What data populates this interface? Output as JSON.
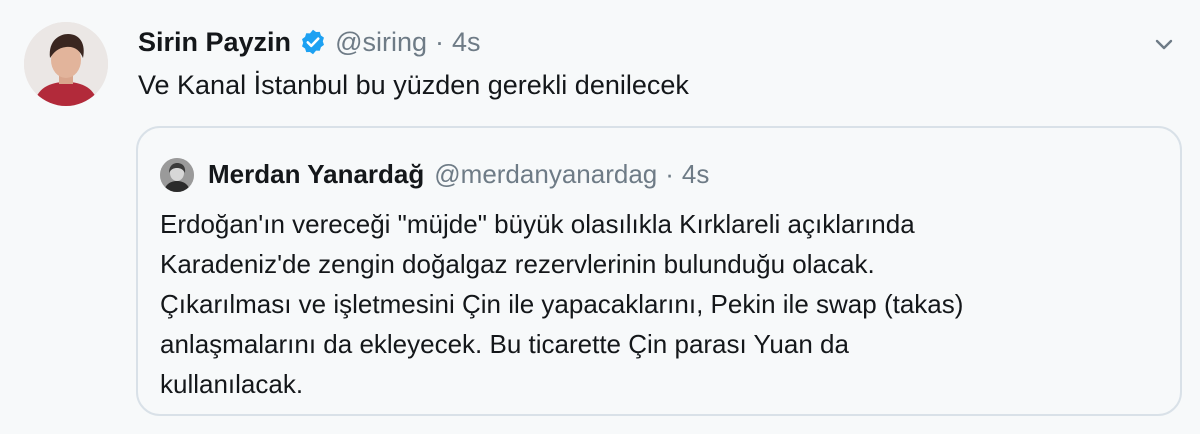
{
  "tweet": {
    "author": {
      "display_name": "Sirin Payzin",
      "handle": "@siring",
      "verified": true,
      "avatar_icon": "author-avatar"
    },
    "separator": "·",
    "time": "4s",
    "text": "Ve Kanal İstanbul bu yüzden gerekli denilecek",
    "menu_icon": "chevron-down-icon"
  },
  "quote": {
    "author": {
      "display_name": "Merdan Yanardağ",
      "handle": "@merdanyanardag",
      "avatar_icon": "quoted-author-avatar"
    },
    "separator": "·",
    "time": "4s",
    "lines": [
      "Erdoğan'ın vereceği \"müjde\" büyük olasılıkla Kırklareli açıklarında",
      "Karadeniz'de zengin doğalgaz rezervlerinin bulunduğu olacak.",
      "Çıkarılması ve işletmesini Çin ile yapacaklarını, Pekin ile swap (takas)",
      "anlaşmalarını da ekleyecek. Bu ticarette Çin parası Yuan da",
      "kullanılacak."
    ]
  },
  "colors": {
    "background": "#f7f9fa",
    "text_primary": "#14171a",
    "text_secondary": "#6e7b86",
    "verified_blue": "#1da1f2",
    "quote_border": "#d9e1e8"
  }
}
